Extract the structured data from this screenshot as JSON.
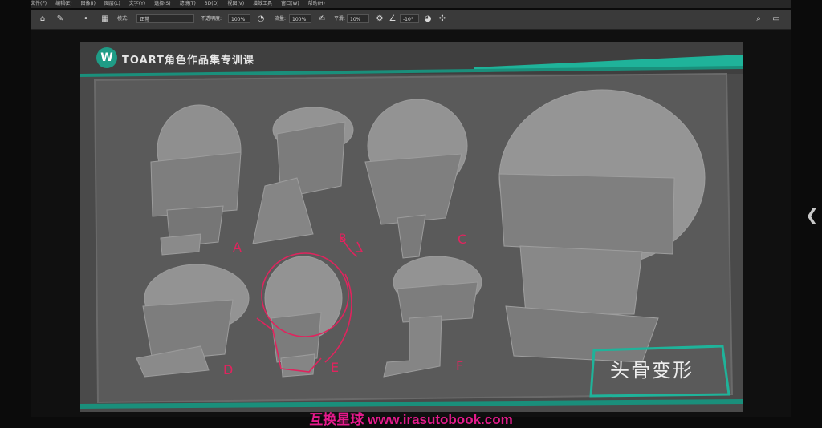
{
  "menu": {
    "items": [
      "文件(F)",
      "编辑(E)",
      "图像(I)",
      "图层(L)",
      "文字(Y)",
      "选择(S)",
      "滤镜(T)",
      "3D(D)",
      "视图(V)",
      "增效工具",
      "窗口(W)",
      "帮助(H)"
    ]
  },
  "options": {
    "mode_label": "模式:",
    "mode_value": "正常",
    "opacity_label": "不透明度:",
    "opacity_value": "100%",
    "flow_label": "流量:",
    "flow_value": "100%",
    "smooth_label": "平滑:",
    "smooth_value": "10%",
    "angle_value": "-10°"
  },
  "slide": {
    "logo_mark": "W",
    "header_title": "TOART角色作品集专训课",
    "topic": "头骨变形",
    "labels": {
      "a": "A",
      "b": "B",
      "c": "C",
      "d": "D",
      "e": "E",
      "f": "F"
    }
  },
  "colors": {
    "accent": "#1fb39a",
    "sketch": "#e0245e"
  },
  "watermark": "互换星球 www.irasutobook.com",
  "side_tab_icon": "chevron-left-icon"
}
